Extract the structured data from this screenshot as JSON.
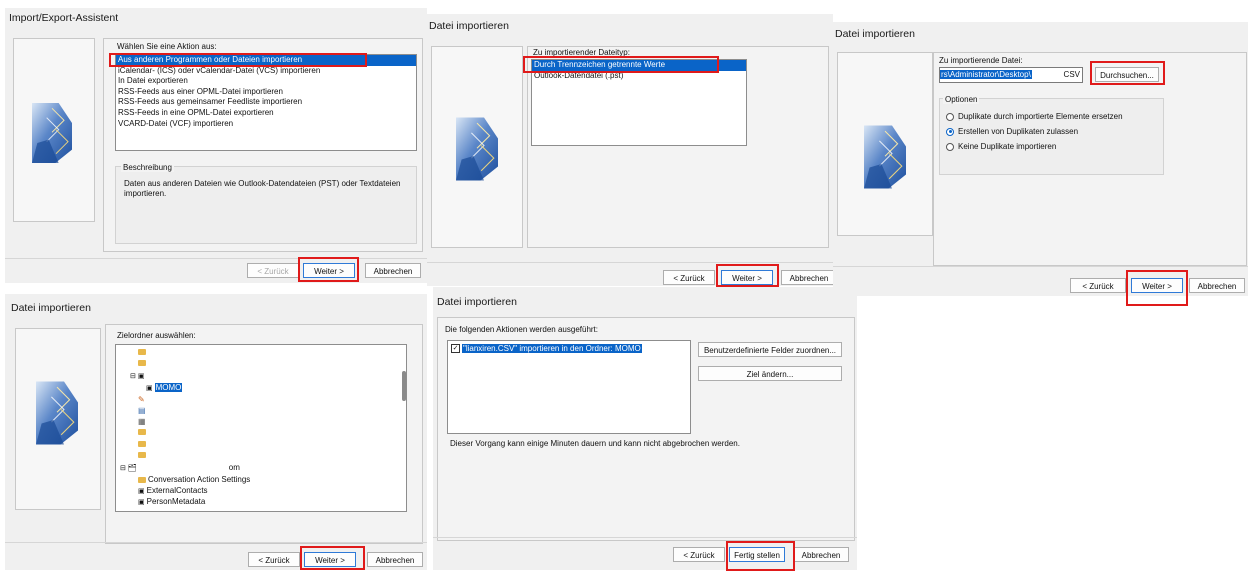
{
  "p1": {
    "title": "Import/Export-Assistent",
    "prompt": "Wählen Sie eine Aktion aus:",
    "actions": [
      "Aus anderen Programmen oder Dateien importieren",
      "iCalendar- (ICS) oder vCalendar-Datei (VCS) importieren",
      "In Datei exportieren",
      "RSS-Feeds aus einer OPML-Datei importieren",
      "RSS-Feeds aus gemeinsamer Feedliste importieren",
      "RSS-Feeds in eine OPML-Datei exportieren",
      "VCARD-Datei (VCF) importieren"
    ],
    "selected_index": 0,
    "desc_label": "Beschreibung",
    "desc_text_1": "Daten aus anderen Dateien wie Outlook-Datendateien (PST) oder Textdateien",
    "desc_text_2": "importieren.",
    "back": "< Zurück",
    "next": "Weiter >",
    "cancel": "Abbrechen"
  },
  "p2": {
    "title": "Datei importieren",
    "prompt": "Zu importierender Dateityp:",
    "types": [
      "Durch Trennzeichen getrennte Werte",
      "Outlook-Datendatei (.pst)"
    ],
    "selected_index": 0,
    "back": "< Zurück",
    "next": "Weiter >",
    "cancel": "Abbrechen"
  },
  "p3": {
    "title": "Datei importieren",
    "file_label": "Zu importierende Datei:",
    "file_value": "rs\\Administrator\\Desktop\\",
    "file_ext": "CSV",
    "browse": "Durchsuchen...",
    "options_label": "Optionen",
    "options": [
      "Duplikate durch importierte Elemente ersetzen",
      "Erstellen von Duplikaten zulassen",
      "Keine Duplikate importieren"
    ],
    "selected_option": 1,
    "back": "< Zurück",
    "next": "Weiter >",
    "cancel": "Abbrechen"
  },
  "p4": {
    "title": "Datei importieren",
    "prompt": "Zielordner auswählen:",
    "selected_folder": "MOMO",
    "mailbox_suffix": "om",
    "tree_items": [
      "Conversation Action Settings",
      "ExternalContacts",
      "PersonMetadata"
    ],
    "back": "< Zurück",
    "next": "Weiter >",
    "cancel": "Abbrechen"
  },
  "p5": {
    "title": "Datei importieren",
    "prompt": "Die folgenden Aktionen werden ausgeführt:",
    "action_item": "\"lianxiren.CSV\" importieren in den Ordner: MOMO",
    "map_fields": "Benutzerdefinierte Felder zuordnen...",
    "change_target": "Ziel ändern...",
    "note": "Dieser Vorgang kann einige Minuten dauern und kann nicht abgebrochen werden.",
    "back": "< Zurück",
    "finish": "Fertig stellen",
    "cancel": "Abbrechen"
  },
  "colors": {
    "highlight": "#e01a1a",
    "selection": "#0a64c8"
  }
}
